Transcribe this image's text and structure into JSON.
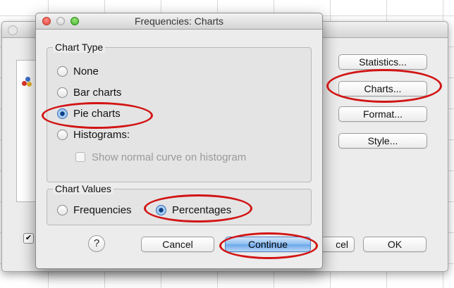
{
  "dialog": {
    "title": "Frequencies: Charts",
    "chart_type": {
      "legend": "Chart Type",
      "options": [
        "None",
        "Bar charts",
        "Pie charts",
        "Histograms:"
      ],
      "selected": "Pie charts",
      "normal_curve_label": "Show normal curve on histogram"
    },
    "chart_values": {
      "legend": "Chart Values",
      "options": [
        "Frequencies",
        "Percentages"
      ],
      "selected": "Percentages"
    },
    "buttons": {
      "help": "?",
      "cancel": "Cancel",
      "continue": "Continue"
    }
  },
  "parent": {
    "buttons": [
      "Statistics...",
      "Charts...",
      "Format...",
      "Style..."
    ],
    "bottom": {
      "cancel_partial": "cel",
      "ok": "OK"
    }
  },
  "colors": {
    "highlight": "#d21414",
    "default_button": "#6aa6ea"
  }
}
